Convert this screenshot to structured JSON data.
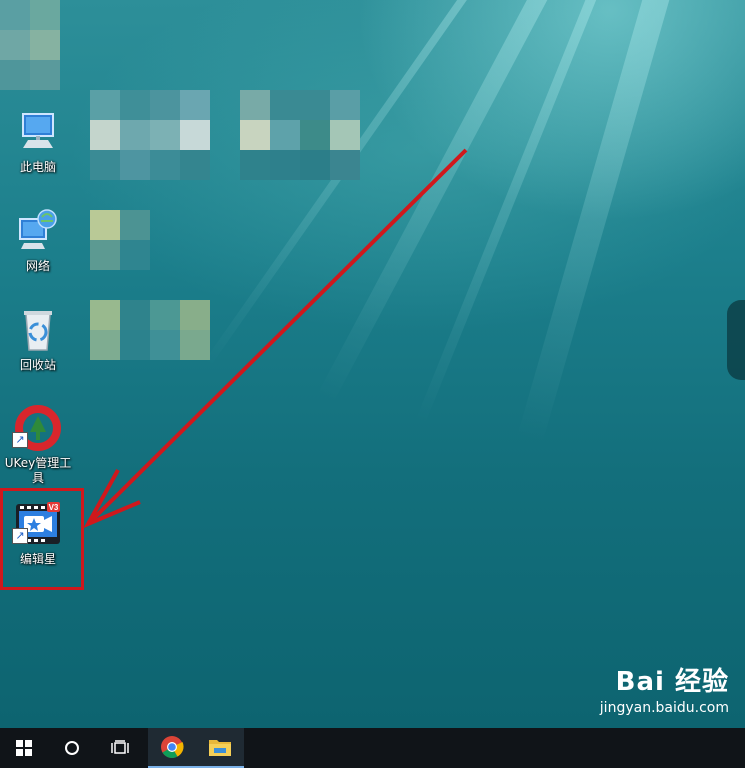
{
  "desktop_icons": [
    {
      "label": "此电脑"
    },
    {
      "label": "网络"
    },
    {
      "label": "回收站"
    },
    {
      "label": "UKey管理工具"
    },
    {
      "label": "编辑星",
      "badge": "V3"
    }
  ],
  "shortcut_glyph": "↗",
  "taskbar": {
    "items": [
      "windows-start-icon",
      "search-circle-icon",
      "task-view-icon",
      "chrome-icon",
      "file-explorer-icon"
    ]
  },
  "watermark": {
    "logo_text": "Bai 经验",
    "url": "jingyan.baidu.com"
  },
  "colors": {
    "highlight": "#d0181c",
    "taskbar_bg": "#101418",
    "water_top": "#2d8f99",
    "water_bottom": "#0d6470"
  }
}
